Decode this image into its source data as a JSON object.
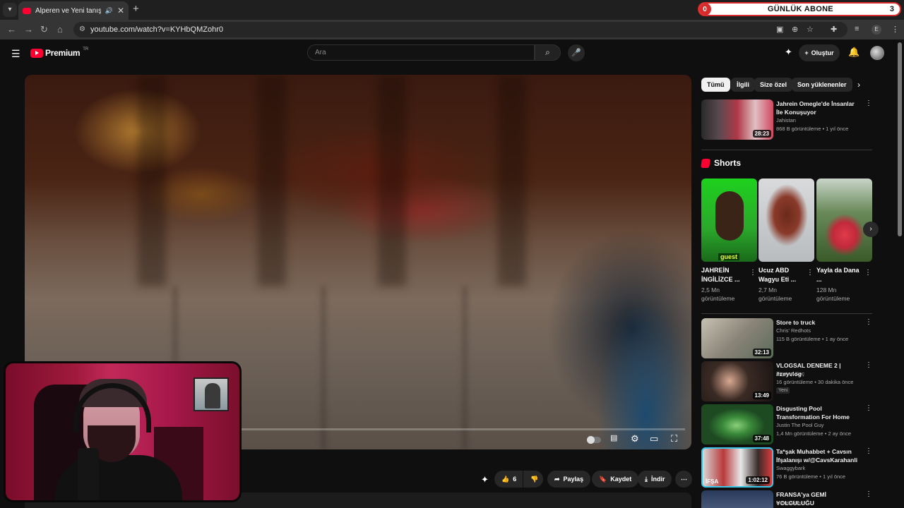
{
  "browser": {
    "tab_title": "Alperen ve Yeni tanıştığımı",
    "url": "youtube.com/watch?v=KYHbQMZohr0",
    "new_tab": "+",
    "close_tab": "✕",
    "profile_initial": "E"
  },
  "overlay": {
    "left_count": "0",
    "label": "GÜNLÜK ABONE",
    "right_count": "3"
  },
  "youtube": {
    "logo_text": "Premium",
    "country": "TR",
    "search_placeholder": "Ara",
    "create_label": "Oluştur"
  },
  "actions": {
    "likes": "6",
    "share": "Paylaş",
    "save": "Kaydet",
    "download": "İndir"
  },
  "chips": [
    "Tümü",
    "İlgili",
    "Size özel",
    "Son yüklenenler"
  ],
  "related": [
    {
      "title": "Jahrein Omegle'de İnsanlar İle Konuşuyor",
      "channel": "Jahistan",
      "meta": "868 B görüntüleme • 1 yıl önce",
      "duration": "28:23"
    }
  ],
  "shorts": {
    "heading": "Shorts",
    "items": [
      {
        "title": "JAHREİN İNGİLİZCE ...",
        "views": "2,5 Mn görüntüleme",
        "overlay_text": "guest"
      },
      {
        "title": "Ucuz ABD Wagyu Eti ...",
        "views": "2,7 Mn görüntüleme"
      },
      {
        "title": "Yayla da Dana ...",
        "views": "128 Mn görüntüleme"
      }
    ]
  },
  "videos": [
    {
      "title": "Store to truck",
      "channel": "Chris' Redhots",
      "meta": "115 B görüntüleme • 1 ay önce",
      "duration": "32:13",
      "badge": ""
    },
    {
      "title": "VLOGSAL DENEME 2 | #zeyvlog",
      "channel": "Zeynep Koç",
      "meta": "16 görüntüleme • 30 dakika önce",
      "duration": "13:49",
      "badge": "Yeni"
    },
    {
      "title": "Disgusting Pool Transformation For Home Sellers POV and ...",
      "channel": "Justin The Pool Guy",
      "meta": "1,4 Mn görüntüleme • 2 ay önce",
      "duration": "37:48",
      "badge": ""
    },
    {
      "title": "Ta*şak Muhabbet + Cavsın İfşalanışı w/@CavsKarahanli ...",
      "channel": "Swaggybark",
      "meta": "76 B görüntüleme • 1 yıl önce",
      "duration": "1:02:12",
      "badge": "",
      "thumb_text": "İFŞA"
    },
    {
      "title": "FRANSA'ya GEMİ YOLCULUĞU",
      "channel": "Umut Akıncı",
      "meta": "",
      "duration": "",
      "badge": ""
    }
  ]
}
